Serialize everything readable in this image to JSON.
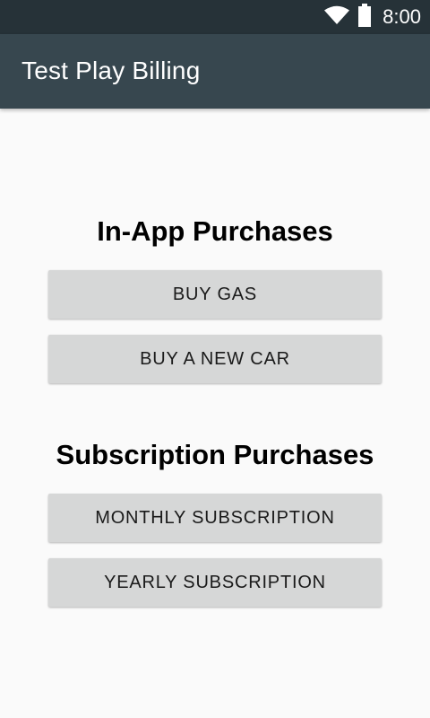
{
  "status_bar": {
    "time": "8:00",
    "icons": [
      "wifi-icon",
      "battery-icon"
    ],
    "background": "#263238"
  },
  "app_bar": {
    "title": "Test Play Billing",
    "background": "#37474f"
  },
  "sections": {
    "in_app": {
      "title": "In-App Purchases",
      "buttons": [
        "BUY GAS",
        "BUY A NEW CAR"
      ]
    },
    "subscriptions": {
      "title": "Subscription Purchases",
      "buttons": [
        "MONTHLY SUBSCRIPTION",
        "YEARLY SUBSCRIPTION"
      ]
    }
  },
  "colors": {
    "button": "#d6d7d7",
    "page_background": "#fafafa"
  }
}
